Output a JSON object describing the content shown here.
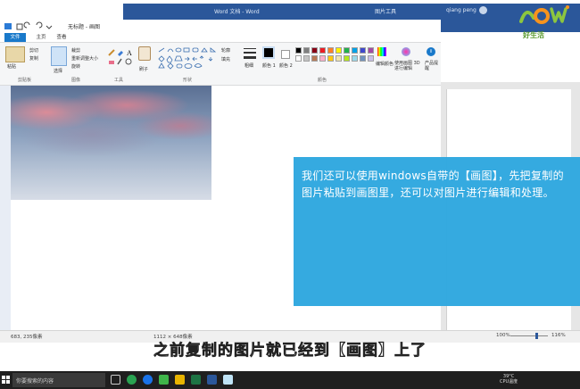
{
  "word": {
    "title": "Word 文档 - Word",
    "context_tab": "图片工具",
    "user": "qiang peng"
  },
  "paint": {
    "title": "无标题 - 画图",
    "tabs": [
      "文件",
      "主页",
      "查看"
    ],
    "ribbon": {
      "paste": "粘贴",
      "cut": "剪切",
      "copy": "复制",
      "select": "选择",
      "crop": "裁剪",
      "resize": "重新调整大小",
      "rotate": "旋转",
      "brushes": "刷子",
      "outline": "轮廓",
      "fill": "填充",
      "size": "粗细",
      "color1": "颜色 1",
      "color2": "颜色 2",
      "edit_colors": "编辑颜色",
      "paint3d": "使用画图 3D 进行编辑",
      "product_alert": "产品提醒"
    },
    "groups": {
      "clipboard": "剪贴板",
      "image": "图像",
      "tools": "工具",
      "shapes": "形状",
      "colors": "颜色"
    },
    "palette": [
      "#000000",
      "#7f7f7f",
      "#880015",
      "#ed1c24",
      "#ff7f27",
      "#fff200",
      "#22b14c",
      "#00a2e8",
      "#3f48cc",
      "#a349a4",
      "#ffffff",
      "#c3c3c3",
      "#b97a57",
      "#ffaec9",
      "#ffc90e",
      "#efe4b0",
      "#b5e61d",
      "#99d9ea",
      "#7092be",
      "#c8bfe7"
    ],
    "status": {
      "cursor": "683, 235像素",
      "image_size": "1112 × 648像素",
      "zoom": "100%"
    }
  },
  "word_zoom": "116%",
  "overlay": {
    "text": "我们还可以使用windows自带的【画图】，先把复制的图片粘贴到画图里，还可以对图片进行编辑和处理。"
  },
  "subtitle": "之前复制的图片就已经到【画图】上了",
  "taskbar": {
    "search": "你要搜索的内容",
    "tray_line1": "39°C",
    "tray_line2": "CPU温度"
  },
  "logo": {
    "text": "好生活"
  }
}
